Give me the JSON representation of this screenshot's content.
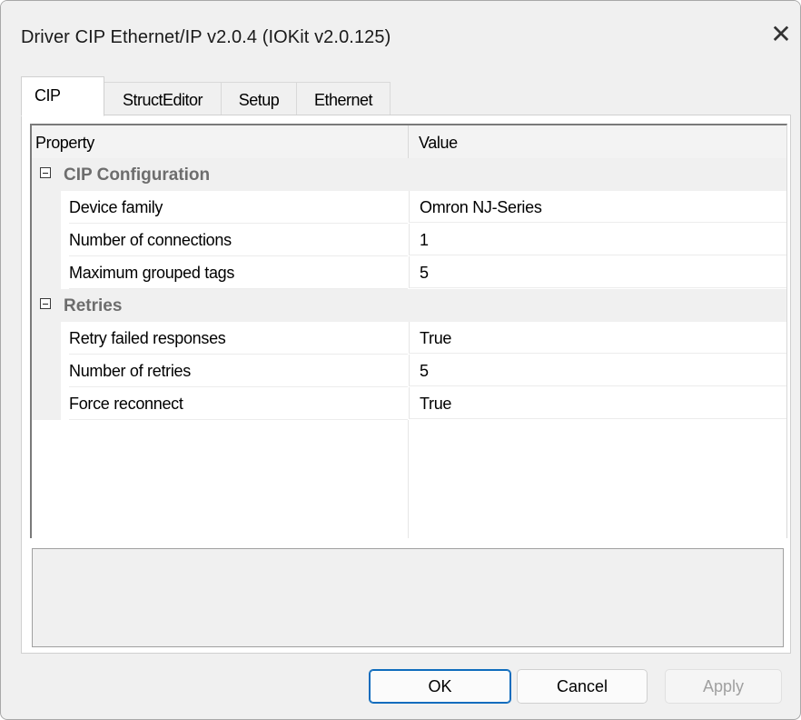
{
  "window": {
    "title": "Driver CIP Ethernet/IP v2.0.4 (IOKit v2.0.125)",
    "close_glyph": "✕"
  },
  "tabs": [
    {
      "label": "CIP",
      "active": true
    },
    {
      "label": "StructEditor",
      "active": false
    },
    {
      "label": "Setup",
      "active": false
    },
    {
      "label": "Ethernet",
      "active": false
    }
  ],
  "grid": {
    "columns": {
      "property": "Property",
      "value": "Value"
    },
    "categories": [
      {
        "label": "CIP Configuration",
        "expanded": true,
        "rows": [
          {
            "name": "Device family",
            "value": "Omron NJ-Series"
          },
          {
            "name": "Number of connections",
            "value": "1"
          },
          {
            "name": "Maximum grouped tags",
            "value": "5"
          }
        ]
      },
      {
        "label": "Retries",
        "expanded": true,
        "rows": [
          {
            "name": "Retry failed responses",
            "value": "True"
          },
          {
            "name": "Number of retries",
            "value": "5"
          },
          {
            "name": "Force reconnect",
            "value": "True"
          }
        ]
      }
    ]
  },
  "buttons": {
    "ok": "OK",
    "cancel": "Cancel",
    "apply": "Apply"
  },
  "colors": {
    "accent": "#0f6cbd",
    "category_text": "#6d6d6d",
    "dialog_bg": "#f0f0f0"
  }
}
